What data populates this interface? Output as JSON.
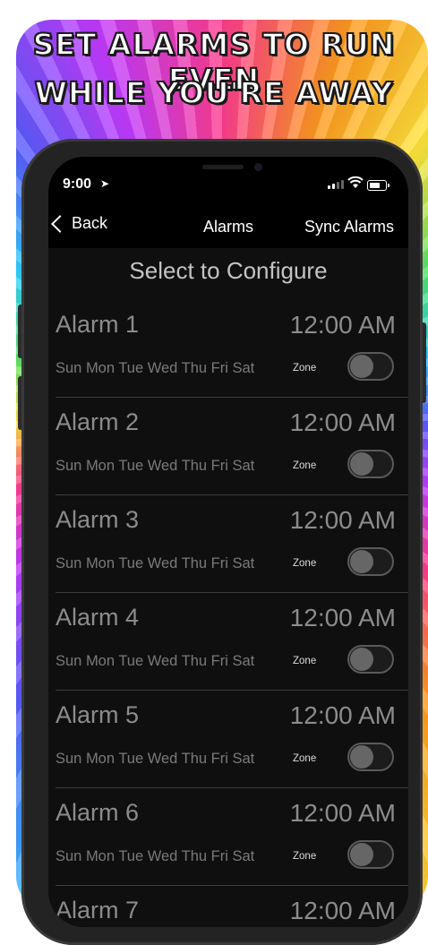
{
  "headline": {
    "line1": "Set Alarms to Run Even",
    "line2": "While You're Away"
  },
  "status_bar": {
    "time": "9:00",
    "location_icon": "location-arrow-icon",
    "signal_icon": "signal-icon",
    "wifi_icon": "wifi-icon",
    "battery_icon": "battery-icon"
  },
  "nav": {
    "back_label": "Back",
    "title": "Alarms",
    "sync_label": "Sync Alarms"
  },
  "section_title": "Select to Configure",
  "alarms": [
    {
      "name": "Alarm 1",
      "time": "12:00 AM",
      "days": "Sun Mon Tue Wed Thu Fri Sat",
      "zone_label": "Zone",
      "enabled": false
    },
    {
      "name": "Alarm 2",
      "time": "12:00 AM",
      "days": "Sun Mon Tue Wed Thu Fri Sat",
      "zone_label": "Zone",
      "enabled": false
    },
    {
      "name": "Alarm 3",
      "time": "12:00 AM",
      "days": "Sun Mon Tue Wed Thu Fri Sat",
      "zone_label": "Zone",
      "enabled": false
    },
    {
      "name": "Alarm 4",
      "time": "12:00 AM",
      "days": "Sun Mon Tue Wed Thu Fri Sat",
      "zone_label": "Zone",
      "enabled": false
    },
    {
      "name": "Alarm 5",
      "time": "12:00 AM",
      "days": "Sun Mon Tue Wed Thu Fri Sat",
      "zone_label": "Zone",
      "enabled": false
    },
    {
      "name": "Alarm 6",
      "time": "12:00 AM",
      "days": "Sun Mon Tue Wed Thu Fri Sat",
      "zone_label": "Zone",
      "enabled": false
    },
    {
      "name": "Alarm 7",
      "time": "12:00 AM",
      "days": "",
      "zone_label": "",
      "enabled": false
    }
  ],
  "colors": {
    "screen_bg": "#0f0f0f",
    "text_dim": "#8c8c8c",
    "divider": "#3c3c3c"
  }
}
